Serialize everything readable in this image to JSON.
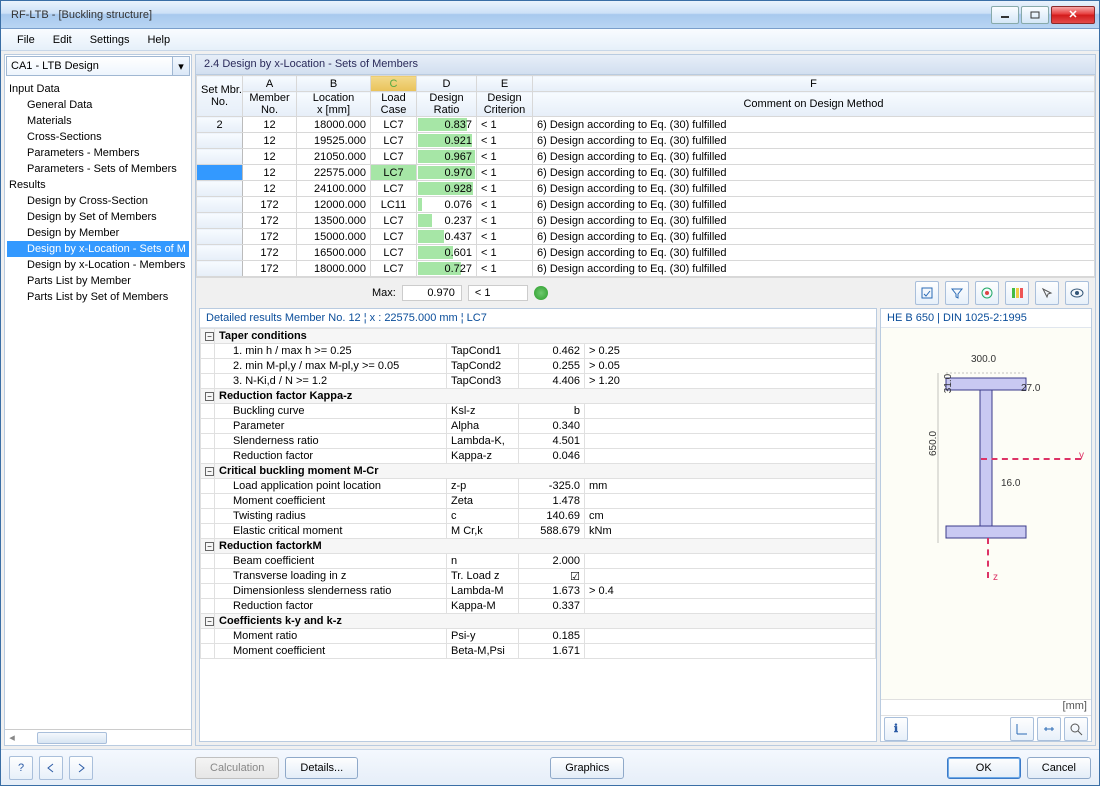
{
  "window_title": "RF-LTB - [Buckling structure]",
  "menu": {
    "file": "File",
    "edit": "Edit",
    "settings": "Settings",
    "help": "Help"
  },
  "combo_text": "CA1 - LTB Design",
  "tree": {
    "input_data": "Input Data",
    "general_data": "General Data",
    "materials": "Materials",
    "cross_sections": "Cross-Sections",
    "parameters_members": "Parameters - Members",
    "parameters_sets": "Parameters - Sets of Members",
    "results": "Results",
    "des_cross_section": "Design by Cross-Section",
    "des_set_members": "Design by Set of Members",
    "des_member": "Design by Member",
    "des_xloc_sets": "Design by x-Location - Sets of M",
    "des_xloc_members": "Design by x-Location - Members",
    "parts_member": "Parts List by Member",
    "parts_set": "Parts List by Set of Members"
  },
  "section_title": "2.4 Design by x-Location - Sets of Members",
  "grid": {
    "corner": "Set Mbr.\nNo.",
    "letters": {
      "A": "A",
      "B": "B",
      "C": "C",
      "D": "D",
      "E": "E",
      "F": "F"
    },
    "headers": {
      "A": "Member\nNo.",
      "B": "Location\nx [mm]",
      "C": "Load\nCase",
      "D": "Design\nRatio",
      "E": "Design\nCriterion",
      "F": "Comment on Design Method"
    },
    "rows": [
      {
        "set": "2",
        "mem": "12",
        "loc": "18000.000",
        "lc": "LC7",
        "ratio": "0.837",
        "crit": "< 1",
        "comment": "6) Design according to Eq. (30) fulfilled"
      },
      {
        "set": "",
        "mem": "12",
        "loc": "19525.000",
        "lc": "LC7",
        "ratio": "0.921",
        "crit": "< 1",
        "comment": "6) Design according to Eq. (30) fulfilled"
      },
      {
        "set": "",
        "mem": "12",
        "loc": "21050.000",
        "lc": "LC7",
        "ratio": "0.967",
        "crit": "< 1",
        "comment": "6) Design according to Eq. (30) fulfilled"
      },
      {
        "set": "",
        "mem": "12",
        "loc": "22575.000",
        "lc": "LC7",
        "ratio": "0.970",
        "crit": "< 1",
        "comment": "6) Design according to Eq. (30) fulfilled",
        "sel": true
      },
      {
        "set": "",
        "mem": "12",
        "loc": "24100.000",
        "lc": "LC7",
        "ratio": "0.928",
        "crit": "< 1",
        "comment": "6) Design according to Eq. (30) fulfilled"
      },
      {
        "set": "",
        "mem": "172",
        "loc": "12000.000",
        "lc": "LC11",
        "ratio": "0.076",
        "crit": "< 1",
        "comment": "6) Design according to Eq. (30) fulfilled"
      },
      {
        "set": "",
        "mem": "172",
        "loc": "13500.000",
        "lc": "LC7",
        "ratio": "0.237",
        "crit": "< 1",
        "comment": "6) Design according to Eq. (30) fulfilled"
      },
      {
        "set": "",
        "mem": "172",
        "loc": "15000.000",
        "lc": "LC7",
        "ratio": "0.437",
        "crit": "< 1",
        "comment": "6) Design according to Eq. (30) fulfilled"
      },
      {
        "set": "",
        "mem": "172",
        "loc": "16500.000",
        "lc": "LC7",
        "ratio": "0.601",
        "crit": "< 1",
        "comment": "6) Design according to Eq. (30) fulfilled"
      },
      {
        "set": "",
        "mem": "172",
        "loc": "18000.000",
        "lc": "LC7",
        "ratio": "0.727",
        "crit": "< 1",
        "comment": "6) Design according to Eq. (30) fulfilled"
      }
    ]
  },
  "max": {
    "label": "Max:",
    "val": "0.970",
    "crit": "< 1"
  },
  "details_title": "Detailed results Member No. 12 ¦ x : 22575.000 mm ¦ LC7",
  "details": {
    "sec_taper": "Taper conditions",
    "r_tap1": {
      "name": "1. min h / max h >= 0.25",
      "sym": "TapCond1",
      "val": "0.462",
      "unit": "> 0.25"
    },
    "r_tap2": {
      "name": "2. min M-pl,y / max M-pl,y >= 0.05",
      "sym": "TapCond2",
      "val": "0.255",
      "unit": "> 0.05"
    },
    "r_tap3": {
      "name": "3. N-Ki,d / N >= 1.2",
      "sym": "TapCond3",
      "val": "4.406",
      "unit": "> 1.20"
    },
    "sec_kappa": "Reduction factor Kappa-z",
    "r_buck": {
      "name": "Buckling curve",
      "sym": "Ksl-z",
      "val": "b",
      "unit": ""
    },
    "r_alpha": {
      "name": "Parameter",
      "sym": "Alpha",
      "val": "0.340",
      "unit": ""
    },
    "r_slend": {
      "name": "Slenderness ratio",
      "sym": "Lambda-K,",
      "val": "4.501",
      "unit": ""
    },
    "r_kz": {
      "name": "Reduction factor",
      "sym": "Kappa-z",
      "val": "0.046",
      "unit": ""
    },
    "sec_mcr": "Critical buckling moment M-Cr",
    "r_zp": {
      "name": "Load application point location",
      "sym": "z-p",
      "val": "-325.0",
      "unit": "mm"
    },
    "r_zeta": {
      "name": "Moment coefficient",
      "sym": "Zeta",
      "val": "1.478",
      "unit": ""
    },
    "r_c": {
      "name": "Twisting radius",
      "sym": "c",
      "val": "140.69",
      "unit": "cm"
    },
    "r_mcrk": {
      "name": "Elastic critical moment",
      "sym": "M Cr,k",
      "val": "588.679",
      "unit": "kNm"
    },
    "sec_km": "Reduction factorkM",
    "r_n": {
      "name": "Beam coefficient",
      "sym": "n",
      "val": "2.000",
      "unit": ""
    },
    "r_trz": {
      "name": "Transverse loading in z",
      "sym": "Tr. Load z",
      "val": "☑",
      "unit": ""
    },
    "r_lambm": {
      "name": "Dimensionless slenderness ratio",
      "sym": "Lambda-M",
      "val": "1.673",
      "unit": "> 0.4"
    },
    "r_kappm": {
      "name": "Reduction factor",
      "sym": "Kappa-M",
      "val": "0.337",
      "unit": ""
    },
    "sec_kyz": "Coefficients k-y and k-z",
    "r_psiy": {
      "name": "Moment ratio",
      "sym": "Psi-y",
      "val": "0.185",
      "unit": ""
    },
    "r_betam": {
      "name": "Moment coefficient",
      "sym": "Beta-M,Psi",
      "val": "1.671",
      "unit": ""
    }
  },
  "cs": {
    "title": "HE B 650 | DIN 1025-2:1995",
    "dim_w": "300.0",
    "dim_h": "650.0",
    "dim_tf": "31.0",
    "dim_tw": "16.0",
    "dim_r": "27.0",
    "axis_y": "y",
    "axis_z": "z",
    "unit": "[mm]"
  },
  "buttons": {
    "calc": "Calculation",
    "details": "Details...",
    "graphics": "Graphics",
    "ok": "OK",
    "cancel": "Cancel"
  }
}
